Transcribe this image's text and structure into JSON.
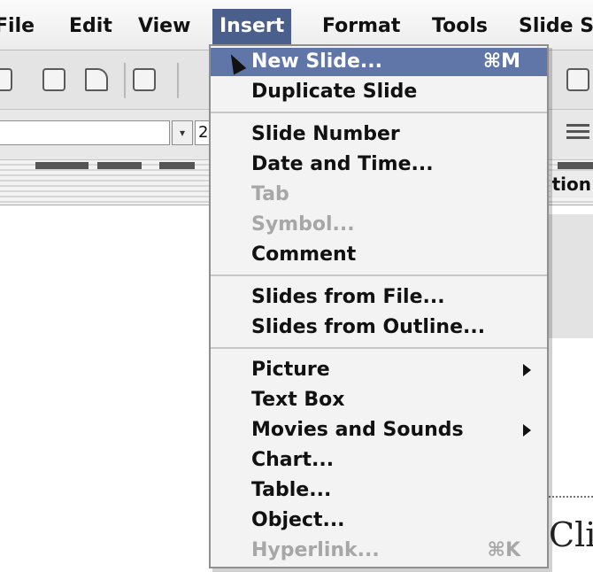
{
  "menubar": {
    "items": [
      "File",
      "Edit",
      "View",
      "Insert",
      "Format",
      "Tools",
      "Slide Sh"
    ]
  },
  "toolbar": {
    "font_size_value": "2"
  },
  "ruler": {
    "label_partial": "tion"
  },
  "slide": {
    "text_partial": "Cli"
  },
  "insert_menu": {
    "items": [
      {
        "label": "New Slide...",
        "shortcut": "⌘M",
        "state": "highlighted"
      },
      {
        "label": "Duplicate Slide",
        "shortcut": "",
        "state": "enabled"
      },
      {
        "label": "Slide Number",
        "shortcut": "",
        "state": "enabled"
      },
      {
        "label": "Date and Time...",
        "shortcut": "",
        "state": "enabled"
      },
      {
        "label": "Tab",
        "shortcut": "",
        "state": "disabled"
      },
      {
        "label": "Symbol...",
        "shortcut": "",
        "state": "disabled"
      },
      {
        "label": "Comment",
        "shortcut": "",
        "state": "enabled"
      },
      {
        "label": "Slides from File...",
        "shortcut": "",
        "state": "enabled"
      },
      {
        "label": "Slides from Outline...",
        "shortcut": "",
        "state": "enabled"
      },
      {
        "label": "Picture",
        "shortcut": "",
        "state": "enabled",
        "submenu": true
      },
      {
        "label": "Text Box",
        "shortcut": "",
        "state": "enabled"
      },
      {
        "label": "Movies and Sounds",
        "shortcut": "",
        "state": "enabled",
        "submenu": true
      },
      {
        "label": "Chart...",
        "shortcut": "",
        "state": "enabled"
      },
      {
        "label": "Table...",
        "shortcut": "",
        "state": "enabled"
      },
      {
        "label": "Object...",
        "shortcut": "",
        "state": "enabled"
      },
      {
        "label": "Hyperlink...",
        "shortcut": "⌘K",
        "state": "disabled"
      }
    ]
  },
  "colors": {
    "menu_highlight": "#6176a8",
    "active_menu_title": "#4a5f8c",
    "disabled_text": "#a7a7a7"
  }
}
